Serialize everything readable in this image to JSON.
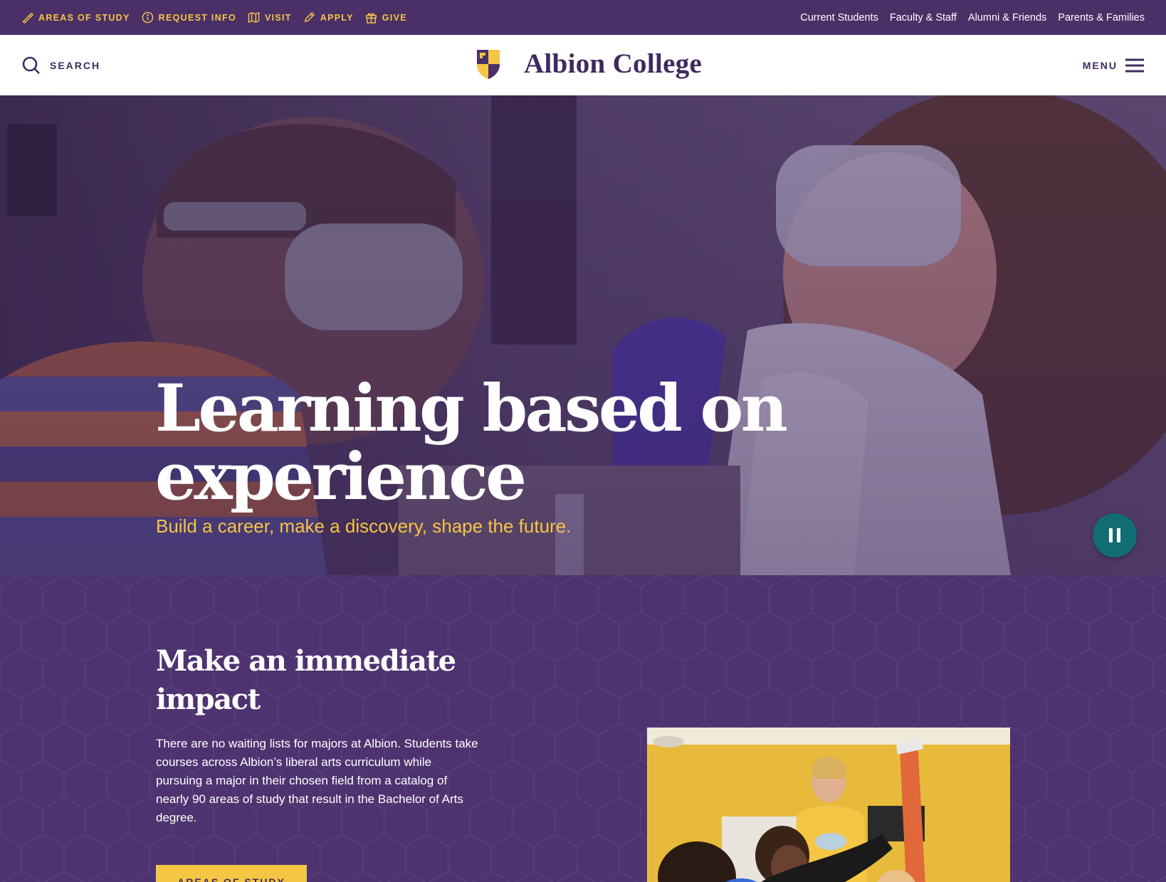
{
  "utility": {
    "links": [
      {
        "label": "Areas of Study",
        "icon": "compass-pen-icon"
      },
      {
        "label": "Request Info",
        "icon": "info-circle-icon"
      },
      {
        "label": "Visit",
        "icon": "map-icon"
      },
      {
        "label": "Apply",
        "icon": "pencil-icon"
      },
      {
        "label": "Give",
        "icon": "gift-icon"
      }
    ],
    "audiences": [
      "Current Students",
      "Faculty & Staff",
      "Alumni & Friends",
      "Parents & Families"
    ]
  },
  "header": {
    "search_label": "Search",
    "brand_name": "Albion College",
    "menu_label": "Menu"
  },
  "hero": {
    "title": "Learning based on experience",
    "subtitle": "Build a career, make a discovery, shape the future.",
    "pause_label": "Pause"
  },
  "impact": {
    "title": "Make an immediate impact",
    "body": "There are no waiting lists for majors at Albion. Students take courses across Albion’s liberal arts curriculum while pursuing a major in their chosen field from a catalog of nearly 90 areas of study that result in the Bachelor of Arts degree.",
    "cta_label": "Areas of Study"
  },
  "colors": {
    "purple": "#4b3068",
    "gold": "#f5c544",
    "teal": "#116d73",
    "white": "#ffffff"
  }
}
